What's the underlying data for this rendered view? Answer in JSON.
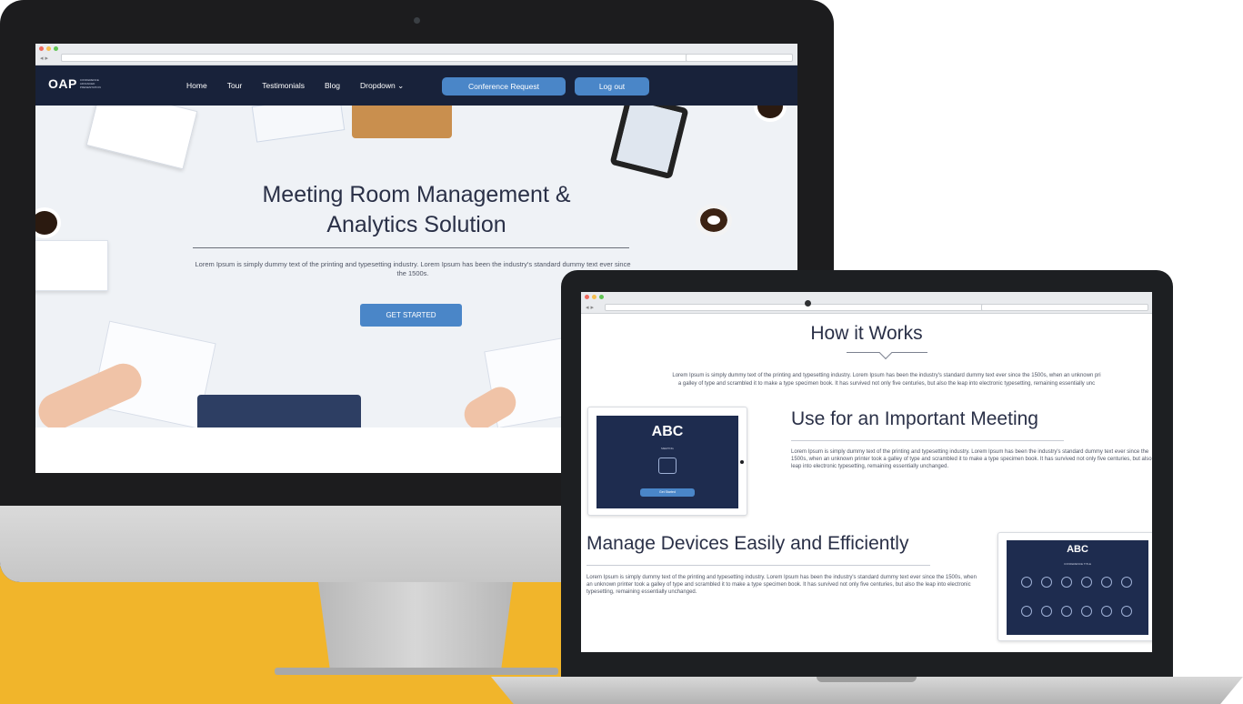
{
  "desktop": {
    "nav": {
      "logo": "OAP",
      "logo_sub": "CONFERENCE ADVANCED PRESENTATION",
      "links": [
        "Home",
        "Tour",
        "Testimonials",
        "Blog",
        "Dropdown ⌄"
      ],
      "request_button": "Conference Request",
      "logout_button": "Log out"
    },
    "hero": {
      "title_line1": "Meeting Room Management &",
      "title_line2": "Analytics Solution",
      "text": "Lorem Ipsum is simply dummy text of the printing and typesetting industry. Lorem Ipsum has been the industry's standard dummy text ever since the 1500s.",
      "cta": "GET STARTED"
    }
  },
  "laptop": {
    "section_title": "How it Works",
    "intro_line1": "Lorem Ipsum is simply dummy text of the printing and typesetting industry. Lorem Ipsum has been the industry's standard dummy text ever since the 1500s, when an unknown pri",
    "intro_line2": "a galley of type and scrambled it to make a type specimen book. It has survived not only five centuries, but also the leap into electronic typesetting, remaining essentially unc",
    "feature1": {
      "title": "Use for an Important Meeting",
      "text": "Lorem Ipsum is simply dummy text of the printing and typesetting industry. Lorem Ipsum has been the industry's standard dummy text ever since the 1500s, when an unknown printer took a galley of type and scrambled it to make a type specimen book. It has survived not only five centuries, but also the leap into electronic typesetting, remaining essentially unchanged.",
      "card_title": "ABC",
      "card_sub": "MEETING",
      "card_btn": "Get Started"
    },
    "feature2": {
      "title": "Manage Devices Easily and Efficiently",
      "text": "Lorem Ipsum is simply dummy text of the printing and typesetting industry. Lorem Ipsum has been the industry's standard dummy text ever since the 1500s, when an unknown printer took a galley of type and scrambled it to make a type specimen book. It has survived not only five centuries, but also the leap into electronic typesetting, remaining essentially unchanged.",
      "card_title": "ABC",
      "card_sub": "CONFERENCE TITLE"
    }
  }
}
